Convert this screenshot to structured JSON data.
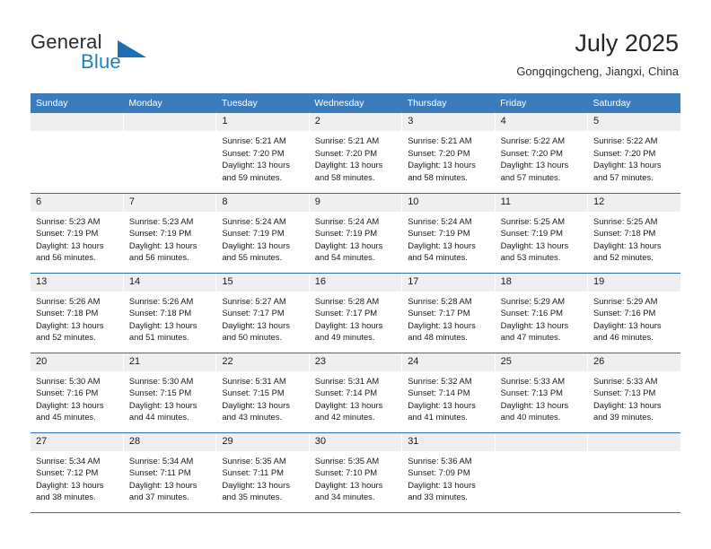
{
  "brand": {
    "name_part1": "General",
    "name_part2": "Blue",
    "flag_icon": "triangle-flag-icon"
  },
  "header": {
    "title": "July 2025",
    "subtitle": "Gongqingcheng, Jiangxi, China"
  },
  "colors": {
    "header_blue": "#3a7cbe",
    "brand_blue": "#1d7fc4",
    "daynum_band": "#efefef",
    "row_divider": "#2f6fae"
  },
  "labels": {
    "sunrise": "Sunrise:",
    "sunset": "Sunset:",
    "daylight": "Daylight:"
  },
  "weekdays": [
    "Sunday",
    "Monday",
    "Tuesday",
    "Wednesday",
    "Thursday",
    "Friday",
    "Saturday"
  ],
  "weeks": [
    [
      {
        "day": "",
        "empty": true
      },
      {
        "day": "",
        "empty": true
      },
      {
        "day": "1",
        "sunrise": "Sunrise: 5:21 AM",
        "sunset": "Sunset: 7:20 PM",
        "daylight1": "Daylight: 13 hours",
        "daylight2": "and 59 minutes."
      },
      {
        "day": "2",
        "sunrise": "Sunrise: 5:21 AM",
        "sunset": "Sunset: 7:20 PM",
        "daylight1": "Daylight: 13 hours",
        "daylight2": "and 58 minutes."
      },
      {
        "day": "3",
        "sunrise": "Sunrise: 5:21 AM",
        "sunset": "Sunset: 7:20 PM",
        "daylight1": "Daylight: 13 hours",
        "daylight2": "and 58 minutes."
      },
      {
        "day": "4",
        "sunrise": "Sunrise: 5:22 AM",
        "sunset": "Sunset: 7:20 PM",
        "daylight1": "Daylight: 13 hours",
        "daylight2": "and 57 minutes."
      },
      {
        "day": "5",
        "sunrise": "Sunrise: 5:22 AM",
        "sunset": "Sunset: 7:20 PM",
        "daylight1": "Daylight: 13 hours",
        "daylight2": "and 57 minutes."
      }
    ],
    [
      {
        "day": "6",
        "sunrise": "Sunrise: 5:23 AM",
        "sunset": "Sunset: 7:19 PM",
        "daylight1": "Daylight: 13 hours",
        "daylight2": "and 56 minutes."
      },
      {
        "day": "7",
        "sunrise": "Sunrise: 5:23 AM",
        "sunset": "Sunset: 7:19 PM",
        "daylight1": "Daylight: 13 hours",
        "daylight2": "and 56 minutes."
      },
      {
        "day": "8",
        "sunrise": "Sunrise: 5:24 AM",
        "sunset": "Sunset: 7:19 PM",
        "daylight1": "Daylight: 13 hours",
        "daylight2": "and 55 minutes."
      },
      {
        "day": "9",
        "sunrise": "Sunrise: 5:24 AM",
        "sunset": "Sunset: 7:19 PM",
        "daylight1": "Daylight: 13 hours",
        "daylight2": "and 54 minutes."
      },
      {
        "day": "10",
        "sunrise": "Sunrise: 5:24 AM",
        "sunset": "Sunset: 7:19 PM",
        "daylight1": "Daylight: 13 hours",
        "daylight2": "and 54 minutes."
      },
      {
        "day": "11",
        "sunrise": "Sunrise: 5:25 AM",
        "sunset": "Sunset: 7:19 PM",
        "daylight1": "Daylight: 13 hours",
        "daylight2": "and 53 minutes."
      },
      {
        "day": "12",
        "sunrise": "Sunrise: 5:25 AM",
        "sunset": "Sunset: 7:18 PM",
        "daylight1": "Daylight: 13 hours",
        "daylight2": "and 52 minutes."
      }
    ],
    [
      {
        "day": "13",
        "sunrise": "Sunrise: 5:26 AM",
        "sunset": "Sunset: 7:18 PM",
        "daylight1": "Daylight: 13 hours",
        "daylight2": "and 52 minutes."
      },
      {
        "day": "14",
        "sunrise": "Sunrise: 5:26 AM",
        "sunset": "Sunset: 7:18 PM",
        "daylight1": "Daylight: 13 hours",
        "daylight2": "and 51 minutes."
      },
      {
        "day": "15",
        "sunrise": "Sunrise: 5:27 AM",
        "sunset": "Sunset: 7:17 PM",
        "daylight1": "Daylight: 13 hours",
        "daylight2": "and 50 minutes."
      },
      {
        "day": "16",
        "sunrise": "Sunrise: 5:28 AM",
        "sunset": "Sunset: 7:17 PM",
        "daylight1": "Daylight: 13 hours",
        "daylight2": "and 49 minutes."
      },
      {
        "day": "17",
        "sunrise": "Sunrise: 5:28 AM",
        "sunset": "Sunset: 7:17 PM",
        "daylight1": "Daylight: 13 hours",
        "daylight2": "and 48 minutes."
      },
      {
        "day": "18",
        "sunrise": "Sunrise: 5:29 AM",
        "sunset": "Sunset: 7:16 PM",
        "daylight1": "Daylight: 13 hours",
        "daylight2": "and 47 minutes."
      },
      {
        "day": "19",
        "sunrise": "Sunrise: 5:29 AM",
        "sunset": "Sunset: 7:16 PM",
        "daylight1": "Daylight: 13 hours",
        "daylight2": "and 46 minutes."
      }
    ],
    [
      {
        "day": "20",
        "sunrise": "Sunrise: 5:30 AM",
        "sunset": "Sunset: 7:16 PM",
        "daylight1": "Daylight: 13 hours",
        "daylight2": "and 45 minutes."
      },
      {
        "day": "21",
        "sunrise": "Sunrise: 5:30 AM",
        "sunset": "Sunset: 7:15 PM",
        "daylight1": "Daylight: 13 hours",
        "daylight2": "and 44 minutes."
      },
      {
        "day": "22",
        "sunrise": "Sunrise: 5:31 AM",
        "sunset": "Sunset: 7:15 PM",
        "daylight1": "Daylight: 13 hours",
        "daylight2": "and 43 minutes."
      },
      {
        "day": "23",
        "sunrise": "Sunrise: 5:31 AM",
        "sunset": "Sunset: 7:14 PM",
        "daylight1": "Daylight: 13 hours",
        "daylight2": "and 42 minutes."
      },
      {
        "day": "24",
        "sunrise": "Sunrise: 5:32 AM",
        "sunset": "Sunset: 7:14 PM",
        "daylight1": "Daylight: 13 hours",
        "daylight2": "and 41 minutes."
      },
      {
        "day": "25",
        "sunrise": "Sunrise: 5:33 AM",
        "sunset": "Sunset: 7:13 PM",
        "daylight1": "Daylight: 13 hours",
        "daylight2": "and 40 minutes."
      },
      {
        "day": "26",
        "sunrise": "Sunrise: 5:33 AM",
        "sunset": "Sunset: 7:13 PM",
        "daylight1": "Daylight: 13 hours",
        "daylight2": "and 39 minutes."
      }
    ],
    [
      {
        "day": "27",
        "sunrise": "Sunrise: 5:34 AM",
        "sunset": "Sunset: 7:12 PM",
        "daylight1": "Daylight: 13 hours",
        "daylight2": "and 38 minutes."
      },
      {
        "day": "28",
        "sunrise": "Sunrise: 5:34 AM",
        "sunset": "Sunset: 7:11 PM",
        "daylight1": "Daylight: 13 hours",
        "daylight2": "and 37 minutes."
      },
      {
        "day": "29",
        "sunrise": "Sunrise: 5:35 AM",
        "sunset": "Sunset: 7:11 PM",
        "daylight1": "Daylight: 13 hours",
        "daylight2": "and 35 minutes."
      },
      {
        "day": "30",
        "sunrise": "Sunrise: 5:35 AM",
        "sunset": "Sunset: 7:10 PM",
        "daylight1": "Daylight: 13 hours",
        "daylight2": "and 34 minutes."
      },
      {
        "day": "31",
        "sunrise": "Sunrise: 5:36 AM",
        "sunset": "Sunset: 7:09 PM",
        "daylight1": "Daylight: 13 hours",
        "daylight2": "and 33 minutes."
      },
      {
        "day": "",
        "empty": true
      },
      {
        "day": "",
        "empty": true
      }
    ]
  ]
}
